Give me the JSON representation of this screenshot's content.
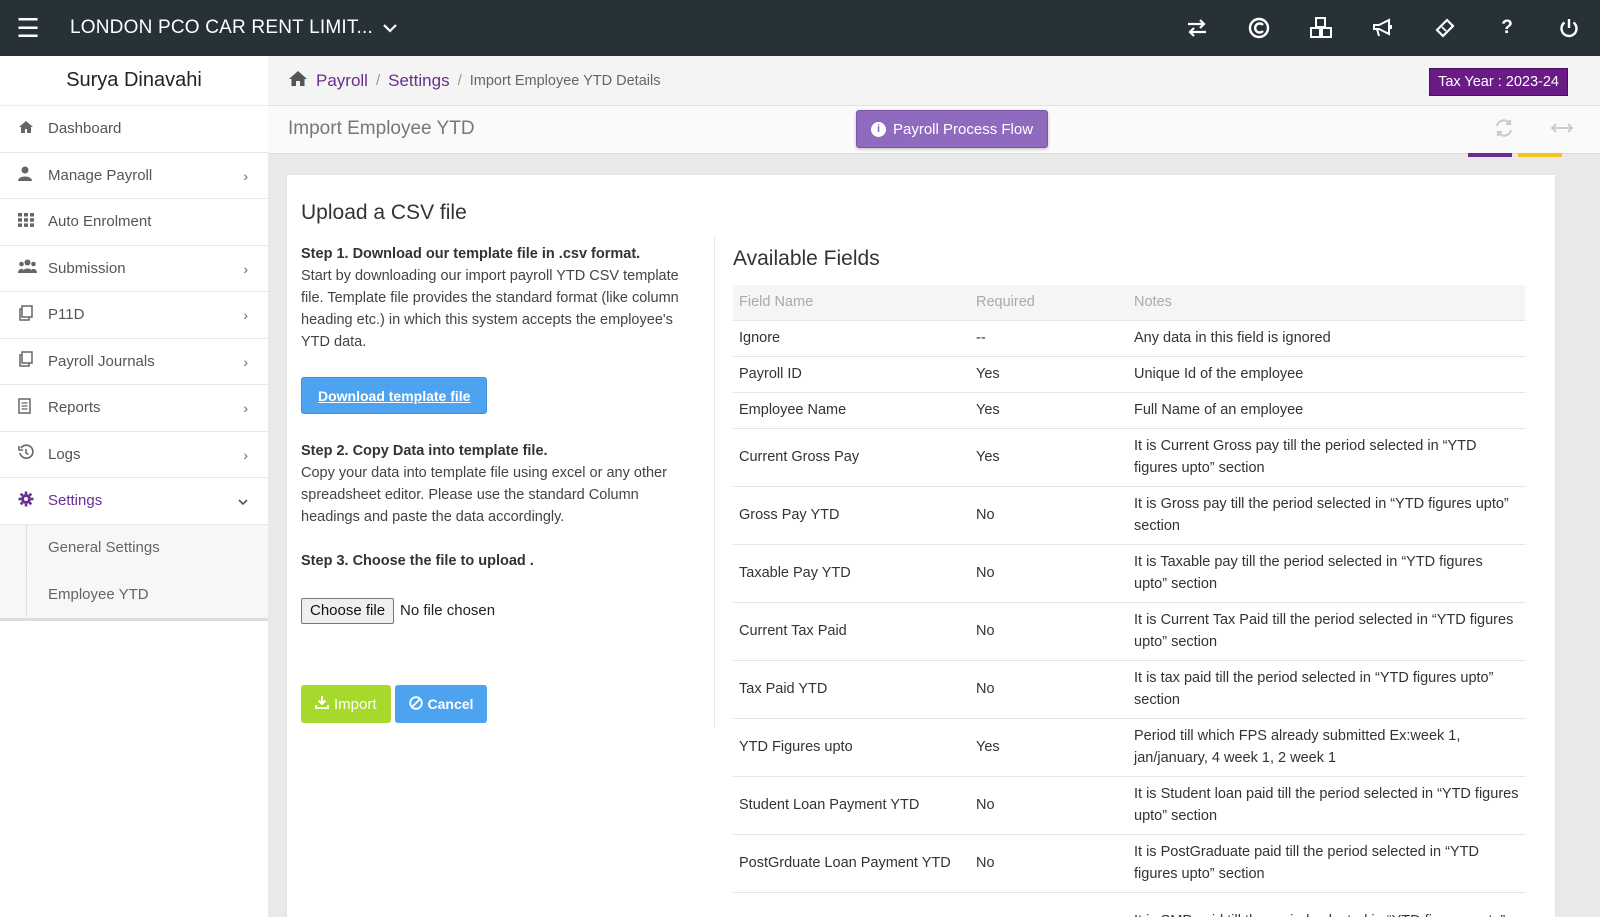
{
  "topbar": {
    "company": "LONDON PCO CAR RENT LIMIT...",
    "icons": [
      "exchange-icon",
      "currency-icon",
      "cubes-icon",
      "bullhorn-icon",
      "ticket-icon",
      "help-icon",
      "power-icon"
    ]
  },
  "sidebar": {
    "user_name": "Surya Dinavahi",
    "items": [
      {
        "label": "Dashboard",
        "icon": "home-icon"
      },
      {
        "label": "Manage Payroll",
        "icon": "user-icon"
      },
      {
        "label": "Auto Enrolment",
        "icon": "grid-icon"
      },
      {
        "label": "Submission",
        "icon": "users-icon"
      },
      {
        "label": "P11D",
        "icon": "copy-icon"
      },
      {
        "label": "Payroll Journals",
        "icon": "copy-icon"
      },
      {
        "label": "Reports",
        "icon": "report-icon"
      },
      {
        "label": "Logs",
        "icon": "history-icon"
      },
      {
        "label": "Settings",
        "icon": "gear-icon"
      }
    ],
    "subitems": [
      {
        "label": "General Settings"
      },
      {
        "label": "Employee YTD"
      }
    ]
  },
  "breadcrumb": {
    "payroll": "Payroll",
    "settings": "Settings",
    "current": "Import Employee YTD Details"
  },
  "tax_year": "Tax Year : 2023-24",
  "page": {
    "title": "Import Employee YTD",
    "process_flow_label": "Payroll Process Flow",
    "accent_colors": {
      "purple": "#6a2d91",
      "yellow": "#f5c518"
    }
  },
  "upload": {
    "title": "Upload a CSV file",
    "step1_title": "Step 1. Download our template file in .csv format.",
    "step1_text": "Start by downloading our import payroll YTD CSV template file. Template file provides the standard format (like column heading etc.) in which this system accepts the employee's YTD data.",
    "download_label": "Download template file",
    "step2_title": "Step 2. Copy Data into template file.",
    "step2_text": "Copy your data into template file using excel or any other spreadsheet editor. Please use the standard Column headings and paste the data accordingly.",
    "step3_title": "Step 3. Choose the file to upload .",
    "choose_file_label": "Choose file",
    "no_file_label": "No file chosen",
    "import_label": "Import",
    "cancel_label": "Cancel"
  },
  "available": {
    "title": "Available Fields",
    "headers": [
      "Field Name",
      "Required",
      "Notes"
    ],
    "rows": [
      {
        "name": "Ignore",
        "required": "--",
        "notes": "Any data in this field is ignored"
      },
      {
        "name": "Payroll ID",
        "required": "Yes",
        "notes": "Unique Id of the employee"
      },
      {
        "name": "Employee Name",
        "required": "Yes",
        "notes": "Full Name of an employee"
      },
      {
        "name": "Current Gross Pay",
        "required": "Yes",
        "notes": "It is Current Gross pay till the period selected in “YTD figures upto” section"
      },
      {
        "name": "Gross Pay YTD",
        "required": "No",
        "notes": "It is Gross pay till the period selected in “YTD figures upto” section"
      },
      {
        "name": "Taxable Pay YTD",
        "required": "No",
        "notes": "It is Taxable pay till the period selected in “YTD figures upto” section"
      },
      {
        "name": "Current Tax Paid",
        "required": "No",
        "notes": "It is Current Tax Paid till the period selected in “YTD figures upto” section"
      },
      {
        "name": "Tax Paid YTD",
        "required": "No",
        "notes": "It is tax paid till the period selected in “YTD figures upto” section"
      },
      {
        "name": "YTD Figures upto",
        "required": "Yes",
        "notes": "Period till which FPS already submitted Ex:week 1, jan/january, 4 week 1, 2 week 1"
      },
      {
        "name": "Student Loan Payment YTD",
        "required": "No",
        "notes": "It is Student loan paid till the period selected in “YTD figures upto” section"
      },
      {
        "name": "PostGrduate Loan Payment YTD",
        "required": "No",
        "notes": "It is PostGraduate paid till the period selected in “YTD figures upto” section"
      },
      {
        "name": "",
        "required": "",
        "notes": "It is SMP paid till the period selected in “YTD figures upto”"
      }
    ]
  }
}
